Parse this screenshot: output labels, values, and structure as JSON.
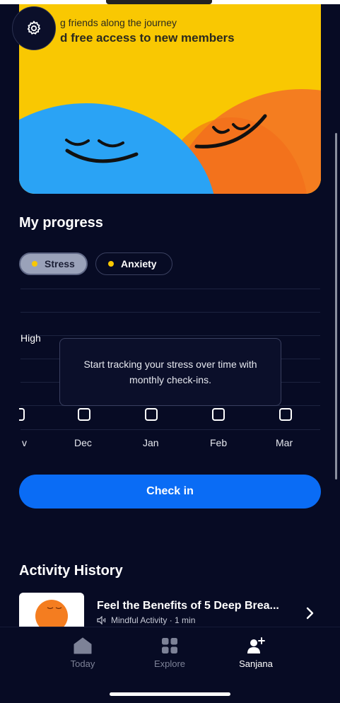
{
  "banner": {
    "subtitle": "g friends along the journey",
    "title": "d free access to new members",
    "colors": {
      "background": "#f9c802",
      "left_face": "#2aa3f5",
      "right_face": "#f47d20"
    }
  },
  "settings": {
    "icon": "gear-icon"
  },
  "progress": {
    "title": "My progress",
    "chips": [
      {
        "label": "Stress",
        "selected": true
      },
      {
        "label": "Anxiety",
        "selected": false
      }
    ],
    "high_label": "High",
    "tooltip": "Start tracking your stress over time with monthly check-ins.",
    "months": [
      "v",
      "Dec",
      "Jan",
      "Feb",
      "Mar"
    ]
  },
  "checkin": {
    "label": "Check in"
  },
  "activity": {
    "title": "Activity History",
    "items": [
      {
        "title": "Feel the Benefits of 5 Deep Brea...",
        "meta": "Mindful Activity · 1 min"
      }
    ]
  },
  "tabs": [
    {
      "label": "Today",
      "icon": "home-icon",
      "active": false
    },
    {
      "label": "Explore",
      "icon": "grid-icon",
      "active": false
    },
    {
      "label": "Sanjana",
      "icon": "profile-add-icon",
      "active": true
    }
  ],
  "colors": {
    "background": "#070b24",
    "accent": "#0a6cf5",
    "dot": "#f9c802"
  }
}
